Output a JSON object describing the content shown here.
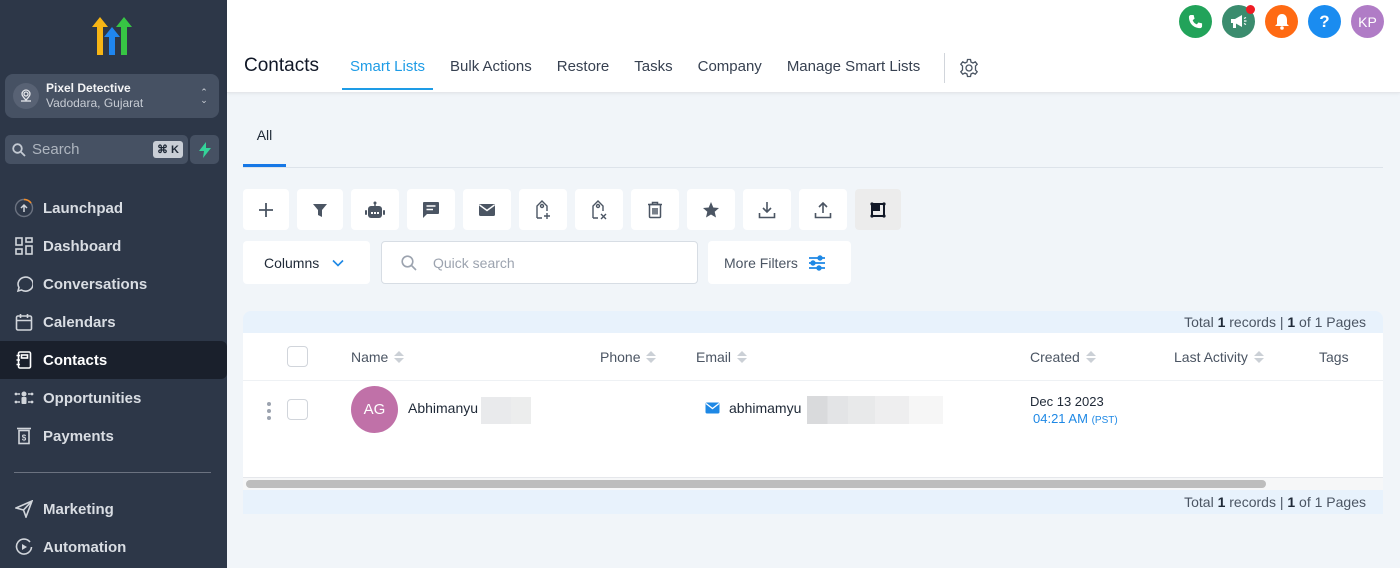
{
  "sidebar": {
    "location": {
      "name": "Pixel Detective",
      "city": "Vadodara, Gujarat"
    },
    "search": {
      "placeholder": "Search",
      "shortcut": "⌘ K"
    },
    "items": [
      {
        "label": "Launchpad",
        "icon": "launchpad-icon"
      },
      {
        "label": "Dashboard",
        "icon": "dashboard-icon"
      },
      {
        "label": "Conversations",
        "icon": "chat-bubble-icon"
      },
      {
        "label": "Calendars",
        "icon": "calendar-icon"
      },
      {
        "label": "Contacts",
        "icon": "contacts-book-icon",
        "active": true
      },
      {
        "label": "Opportunities",
        "icon": "opportunities-icon"
      },
      {
        "label": "Payments",
        "icon": "payments-icon"
      }
    ],
    "items2": [
      {
        "label": "Marketing",
        "icon": "paper-plane-icon"
      },
      {
        "label": "Automation",
        "icon": "automation-icon"
      }
    ]
  },
  "header": {
    "title": "Contacts",
    "tabs": [
      {
        "label": "Smart Lists",
        "active": true
      },
      {
        "label": "Bulk Actions"
      },
      {
        "label": "Restore"
      },
      {
        "label": "Tasks"
      },
      {
        "label": "Company"
      },
      {
        "label": "Manage Smart Lists"
      }
    ],
    "top_icons": [
      {
        "name": "phone-icon",
        "color": "#22a35a"
      },
      {
        "name": "megaphone-icon",
        "color": "#3b8c6e"
      },
      {
        "name": "bell-icon",
        "color": "#ff6a13"
      },
      {
        "name": "help-icon",
        "color": "#1a8cf0",
        "text": "?"
      },
      {
        "name": "user-avatar",
        "color": "#b07cc6",
        "text": "KP"
      }
    ]
  },
  "subtabs": {
    "all": "All"
  },
  "toolbar": {
    "buttons": [
      "add",
      "filter",
      "automation",
      "sms",
      "email",
      "add-tag",
      "remove-tag",
      "delete",
      "star",
      "import",
      "export",
      "merge"
    ]
  },
  "filters": {
    "columns_label": "Columns",
    "quick_search_placeholder": "Quick search",
    "more_filters_label": "More Filters"
  },
  "pagination": {
    "prefix": "Total ",
    "total": "1",
    "middle": " records | ",
    "page": "1",
    "suffix": " of 1 Pages"
  },
  "table": {
    "columns": [
      "Name",
      "Phone",
      "Email",
      "Created",
      "Last Activity",
      "Tags"
    ],
    "rows": [
      {
        "initials": "AG",
        "avatar_color": "#c071a8",
        "name": "Abhimanyu",
        "phone": "",
        "email": "abhimamyu",
        "created_date": "Dec 13 2023",
        "created_time": "04:21 AM",
        "created_tz": "(PST)",
        "last_activity": "",
        "tags": ""
      }
    ]
  },
  "colors": {
    "accent": "#1e9ce6",
    "sidebar_bg": "#2d3748",
    "active_nav": "#1a202c"
  }
}
